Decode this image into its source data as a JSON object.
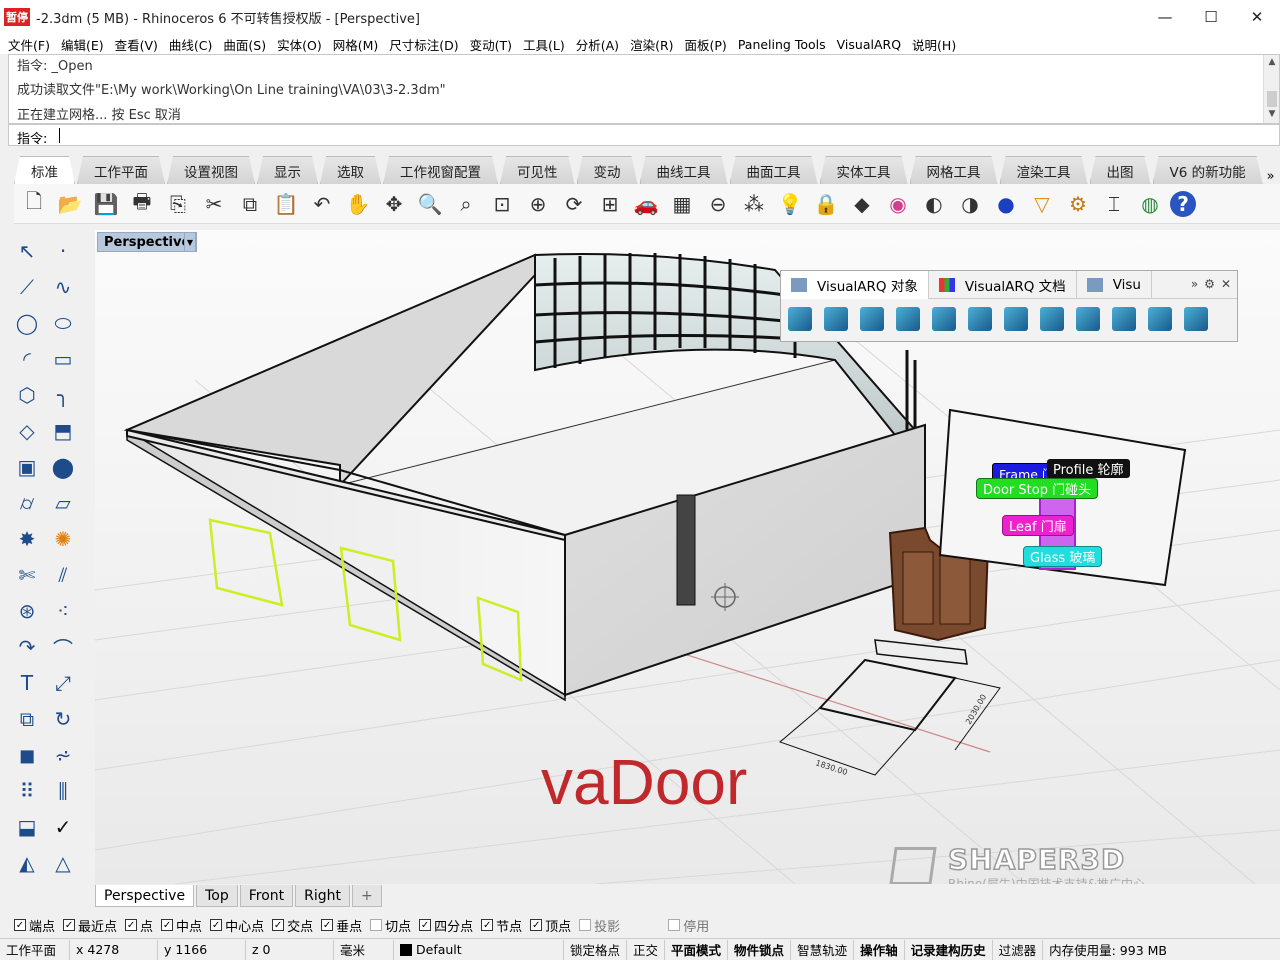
{
  "window": {
    "badge": "暂停",
    "title": "-2.3dm (5 MB) - Rhinoceros 6 不可转售授权版 - [Perspective]",
    "controls": [
      "—",
      "☐",
      "✕"
    ]
  },
  "menu": [
    "文件(F)",
    "编辑(E)",
    "查看(V)",
    "曲线(C)",
    "曲面(S)",
    "实体(O)",
    "网格(M)",
    "尺寸标注(D)",
    "变动(T)",
    "工具(L)",
    "分析(A)",
    "渲染(R)",
    "面板(P)",
    "Paneling Tools",
    "VisualARQ",
    "说明(H)"
  ],
  "command": {
    "history": [
      "指令: _Open",
      "成功读取文件\"E:\\My work\\Working\\On Line training\\VA\\03\\3-2.3dm\"",
      "正在建立网格... 按 Esc 取消"
    ],
    "prompt": "指令:"
  },
  "tabs": [
    "标准",
    "工作平面",
    "设置视图",
    "显示",
    "选取",
    "工作视窗配置",
    "可见性",
    "变动",
    "曲线工具",
    "曲面工具",
    "实体工具",
    "网格工具",
    "渲染工具",
    "出图",
    "V6 的新功能"
  ],
  "tabs_more": "»",
  "toolbar_icons": [
    "new-icon",
    "open-icon",
    "save-icon",
    "print-icon",
    "import-icon",
    "cut-icon",
    "copy-icon",
    "paste-icon",
    "undo-icon",
    "pan-icon",
    "rotate-view-icon",
    "zoom-icon",
    "zoom-window-icon",
    "zoom-extents-icon",
    "zoom-selected-icon",
    "rotate-camera-icon",
    "four-viewports-icon",
    "car-icon",
    "grid-icon",
    "cplane-icon",
    "point-icon",
    "light-icon",
    "lock-icon",
    "material-icon",
    "color-wheel-icon",
    "shaded-sphere-icon",
    "rendered-sphere-icon",
    "blue-sphere-icon",
    "spotlight-icon",
    "settings-gear-icon",
    "dimension-icon",
    "globe-icon",
    "help-icon"
  ],
  "viewport": {
    "label": "Perspective",
    "overlay_text": "vaDoor",
    "watermark": "SHAPER3D",
    "watermark_sub": "Rhino(犀牛)中国技术支持&推广中心",
    "callouts": {
      "frame": "Frame 门",
      "profile": "Profile 轮廓",
      "doorstop": "Door Stop 门碰头",
      "leaf": "Leaf 门扉",
      "glass": "Glass 玻璃"
    },
    "dim_width": "1830.00",
    "dim_depth": "2030.00"
  },
  "visualarq_panel": {
    "tabs": [
      "VisualARQ 对象",
      "VisualARQ 文档",
      "Visu"
    ],
    "more": "»",
    "icons": [
      "wall-icon",
      "curtain-wall-icon",
      "slab-icon",
      "column-icon",
      "door-icon",
      "window-icon",
      "stair-icon",
      "railing-icon",
      "roof-icon",
      "beam-icon",
      "furniture-icon",
      "element-icon"
    ]
  },
  "viewport_tabs": [
    "Perspective",
    "Top",
    "Front",
    "Right",
    "+"
  ],
  "osnaps": [
    {
      "label": "端点",
      "checked": true
    },
    {
      "label": "最近点",
      "checked": true
    },
    {
      "label": "点",
      "checked": true
    },
    {
      "label": "中点",
      "checked": true
    },
    {
      "label": "中心点",
      "checked": true
    },
    {
      "label": "交点",
      "checked": true
    },
    {
      "label": "垂点",
      "checked": true
    },
    {
      "label": "切点",
      "checked": false
    },
    {
      "label": "四分点",
      "checked": true
    },
    {
      "label": "节点",
      "checked": true
    },
    {
      "label": "顶点",
      "checked": true
    },
    {
      "label": "投影",
      "checked": false
    },
    {
      "label": "停用",
      "checked": false
    }
  ],
  "status": {
    "cplane": "工作平面",
    "x": "x 4278",
    "y": "y 1166",
    "z": "z 0",
    "units": "毫米",
    "layer": "Default",
    "items": [
      "锁定格点",
      "正交",
      "平面模式",
      "物件锁点",
      "智慧轨迹",
      "操作轴",
      "记录建构历史",
      "过滤器"
    ],
    "bold_items": [
      "平面模式",
      "物件锁点",
      "操作轴",
      "记录建构历史"
    ],
    "memory": "内存使用量: 993 MB"
  },
  "colors": {
    "wall_outline": "#111111",
    "door_outline": "#ccee22",
    "frame_callout": "#1a1ae0",
    "profile_callout": "#111111",
    "doorstop_callout": "#22dd22",
    "leaf_callout": "#ee22cc",
    "glass_callout": "#22dddd",
    "overlay_text": "#c0282c"
  }
}
